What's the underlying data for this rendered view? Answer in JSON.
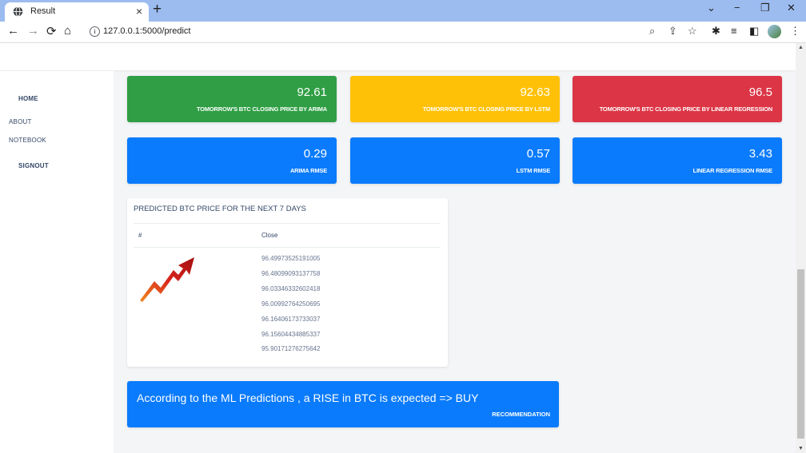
{
  "browser": {
    "tab_title": "Result",
    "tab_close": "×",
    "new_tab": "+",
    "url": "127.0.0.1:5000/predict",
    "window_controls": {
      "chevron": "⌄",
      "minimize": "−",
      "restore": "❐",
      "close": "✕"
    },
    "nav": {
      "back": "←",
      "forward": "→",
      "reload": "⟳",
      "home": "⌂"
    },
    "tools": {
      "zoom": "⌕",
      "share": "⇪",
      "bookmark": "☆",
      "extensions": "✱",
      "reading_list": "≡",
      "side_panel": "◧",
      "menu": "⋮"
    }
  },
  "sidebar": {
    "items": [
      {
        "label": "HOME"
      },
      {
        "label": "ABOUT"
      },
      {
        "label": "NOTEBOOK"
      },
      {
        "label": "SIGNOUT"
      }
    ]
  },
  "cards": {
    "arima_price": {
      "value": "92.61",
      "label": "TOMORROW'S BTC CLOSING PRICE BY ARIMA",
      "color": "#2f9e44"
    },
    "lstm_price": {
      "value": "92.63",
      "label": "TOMORROW'S BTC CLOSING PRICE BY LSTM",
      "color": "#ffc107"
    },
    "lr_price": {
      "value": "96.5",
      "label": "TOMORROW'S BTC CLOSING PRICE BY LINEAR REGRESSION",
      "color": "#dc3545"
    },
    "arima_rmse": {
      "value": "0.29",
      "label": "ARIMA RMSE",
      "color": "#0a7bfc"
    },
    "lstm_rmse": {
      "value": "0.57",
      "label": "LSTM RMSE",
      "color": "#0a7bfc"
    },
    "lr_rmse": {
      "value": "3.43",
      "label": "LINEAR REGRESSION RMSE",
      "color": "#0a7bfc"
    }
  },
  "forecast_table": {
    "title": "PREDICTED BTC PRICE FOR THE NEXT 7 DAYS",
    "columns": [
      "#",
      "Close"
    ],
    "rows": [
      "96.49973525191005",
      "96.48099093137758",
      "96.03346332602418",
      "96.00992764250695",
      "96.16406173733037",
      "96.15604434885337",
      "95.90171276275642"
    ]
  },
  "recommendation": {
    "message": "According to the ML Predictions , a RISE in BTC is expected => BUY",
    "label": "RECOMMENDATION"
  }
}
